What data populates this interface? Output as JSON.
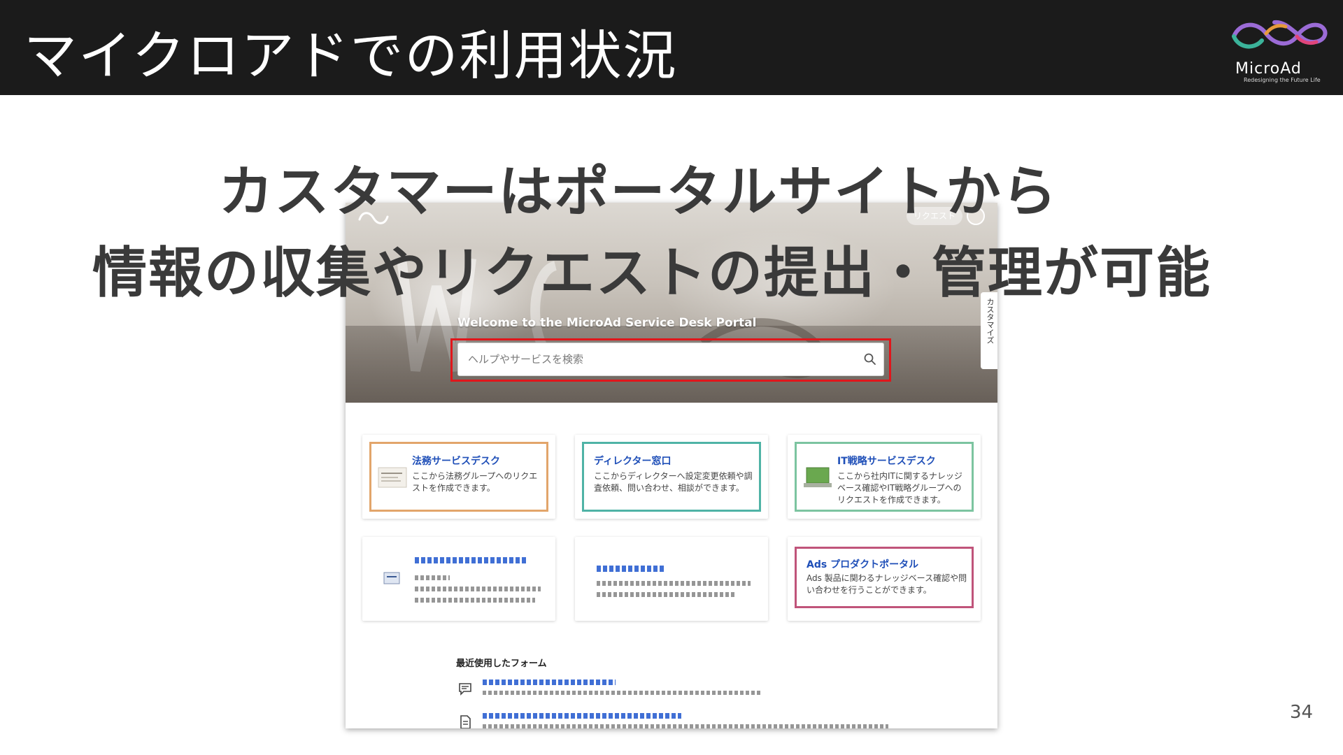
{
  "slide": {
    "title": "マイクロアドでの利用状況",
    "headline_line1": "カスタマーはポータルサイトから",
    "headline_line2": "情報の収集やリクエストの提出・管理が可能",
    "page_number": "34"
  },
  "logo": {
    "name": "MicroAd",
    "tagline": "Redesigning the Future Life"
  },
  "portal": {
    "request_label": "リクエスト",
    "customize_label": "カスタマイズ",
    "welcome": "Welcome to the MicroAd Service Desk Portal",
    "search_placeholder": "ヘルプやサービスを検索",
    "highlight_color": "#e0161b",
    "cards": [
      {
        "title": "法務サービスデスク",
        "description": "ここから法務グループへのリクエストを作成できます。",
        "border_color": "#e2a56b"
      },
      {
        "title": "ディレクター窓口",
        "description": "ここからディレクターへ設定変更依頼や調査依頼、問い合わせ、相談ができます。",
        "border_color": "#4fb3a6"
      },
      {
        "title": "IT戦略サービスデスク",
        "description": "ここから社内ITに関するナレッジベース確認やIT戦略グループへのリクエストを作成できます。",
        "border_color": "#7cc4a0"
      },
      {
        "title": "Ads プロダクトポータル",
        "description": "Ads 製品に関わるナレッジベース確認や問い合わせを行うことができます。",
        "border_color": "#c0547a"
      }
    ],
    "recent_forms_heading": "最近使用したフォーム"
  }
}
